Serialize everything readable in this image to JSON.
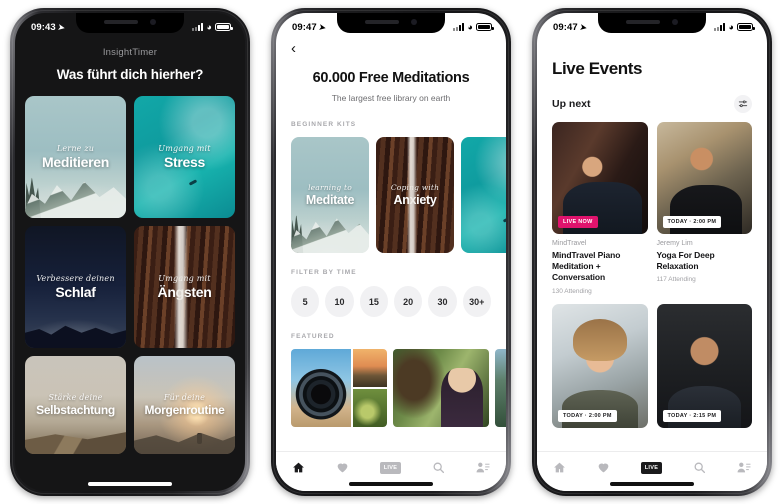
{
  "phone1": {
    "status": {
      "time": "09:43"
    },
    "brand": "InsightTimer",
    "title": "Was führt dich hierher?",
    "cards": [
      {
        "sub": "Lerne zu",
        "title": "Meditieren",
        "art": "art-mountain"
      },
      {
        "sub": "Umgang mit",
        "title": "Stress",
        "art": "art-ocean"
      },
      {
        "sub": "Verbessere deinen",
        "title": "Schlaf",
        "art": "art-night"
      },
      {
        "sub": "Umgang mit",
        "title": "Ängsten",
        "art": "art-wood"
      },
      {
        "sub": "Stärke deine",
        "title": "Selbstachtung",
        "art": "art-road"
      },
      {
        "sub": "Für deine",
        "title": "Morgenroutine",
        "art": "art-sunrise"
      }
    ]
  },
  "phone2": {
    "status": {
      "time": "09:47"
    },
    "back_label": "‹",
    "title": "60.000 Free Meditations",
    "subtitle": "The largest free library on earth",
    "beginner_kits_label": "BEGINNER KITS",
    "kits": [
      {
        "sub": "learning to",
        "title": "Meditate"
      },
      {
        "sub": "Coping with",
        "title": "Anxiety"
      }
    ],
    "filter_label": "FILTER BY TIME",
    "time_chips": [
      "5",
      "10",
      "15",
      "20",
      "30",
      "30+"
    ],
    "featured_label": "FEATURED",
    "tabs": [
      {
        "name": "home",
        "active": true
      },
      {
        "name": "favorites",
        "active": false
      },
      {
        "name": "live",
        "label": "LIVE",
        "active": false
      },
      {
        "name": "search",
        "active": false
      },
      {
        "name": "profile",
        "active": false
      }
    ]
  },
  "phone3": {
    "status": {
      "time": "09:47"
    },
    "title": "Live Events",
    "upnext_label": "Up next",
    "events": [
      {
        "badge": "LIVE NOW",
        "badge_type": "live",
        "host": "MindTravel",
        "title": "MindTravel Piano Meditation + Conversation",
        "attending": "130 Attending"
      },
      {
        "badge": "TODAY · 2:00 PM",
        "badge_type": "today",
        "host": "Jeremy Lim",
        "title": "Yoga For Deep Relaxation",
        "attending": "117 Attending"
      },
      {
        "badge": "TODAY · 2:00 PM",
        "badge_type": "today",
        "host": "",
        "title": "",
        "attending": ""
      },
      {
        "badge": "TODAY · 2:15 PM",
        "badge_type": "today",
        "host": "",
        "title": "",
        "attending": ""
      }
    ],
    "tabs": [
      {
        "name": "home",
        "active": false
      },
      {
        "name": "favorites",
        "active": false
      },
      {
        "name": "live",
        "label": "LIVE",
        "active": true
      },
      {
        "name": "search",
        "active": false
      },
      {
        "name": "profile",
        "active": false
      }
    ]
  },
  "colors": {
    "live_badge": "#e0136d",
    "dark_bg": "#151516",
    "accent_teal": "#12a8a8"
  }
}
